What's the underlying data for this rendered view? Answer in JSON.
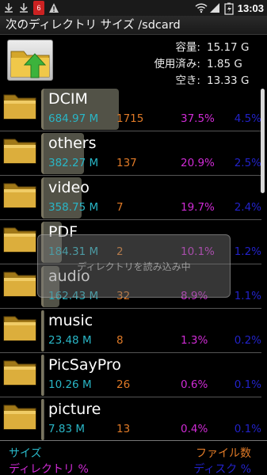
{
  "status_bar": {
    "time": "13:03",
    "badge_count": "6",
    "icons": [
      "download-icon",
      "download-icon",
      "notification-badge",
      "warning-icon",
      "wifi-icon",
      "signal-icon",
      "battery-charging-icon"
    ]
  },
  "title": "次のディレクトリ サイズ /sdcard",
  "storage": {
    "capacity_label": "容量:",
    "capacity_value": "15.17 G",
    "used_label": "使用済み:",
    "used_value": "1.85 G",
    "free_label": "空き:",
    "free_value": "13.33 G"
  },
  "directories": [
    {
      "name": "DCIM",
      "size": "684.97 M",
      "files": "1715",
      "dir_pct": "37.5%",
      "disk_pct": "4.5%",
      "bar_fraction": 0.375
    },
    {
      "name": "others",
      "size": "382.27 M",
      "files": "137",
      "dir_pct": "20.9%",
      "disk_pct": "2.5%",
      "bar_fraction": 0.209
    },
    {
      "name": "video",
      "size": "358.75 M",
      "files": "7",
      "dir_pct": "19.7%",
      "disk_pct": "2.4%",
      "bar_fraction": 0.197
    },
    {
      "name": "PDF",
      "size": "184.31 M",
      "files": "2",
      "dir_pct": "10.1%",
      "disk_pct": "1.2%",
      "bar_fraction": 0.101
    },
    {
      "name": "audio",
      "size": "162.43 M",
      "files": "32",
      "dir_pct": "8.9%",
      "disk_pct": "1.1%",
      "bar_fraction": 0.089
    },
    {
      "name": "music",
      "size": "23.48 M",
      "files": "8",
      "dir_pct": "1.3%",
      "disk_pct": "0.2%",
      "bar_fraction": 0.013
    },
    {
      "name": "PicSayPro",
      "size": "10.26 M",
      "files": "26",
      "dir_pct": "0.6%",
      "disk_pct": "0.1%",
      "bar_fraction": 0.006
    },
    {
      "name": "picture",
      "size": "7.83 M",
      "files": "13",
      "dir_pct": "0.4%",
      "disk_pct": "0.1%",
      "bar_fraction": 0.004
    }
  ],
  "toast": "ディレクトリを読み込み中",
  "legend": {
    "size": "サイズ",
    "files": "ファイル数",
    "dir_pct": "ディレクトリ %",
    "disk_pct": "ディスク %"
  },
  "colors": {
    "size": "#29b6c6",
    "files": "#e07a27",
    "dir_pct": "#d02bd6",
    "disk_pct": "#2222c8"
  }
}
